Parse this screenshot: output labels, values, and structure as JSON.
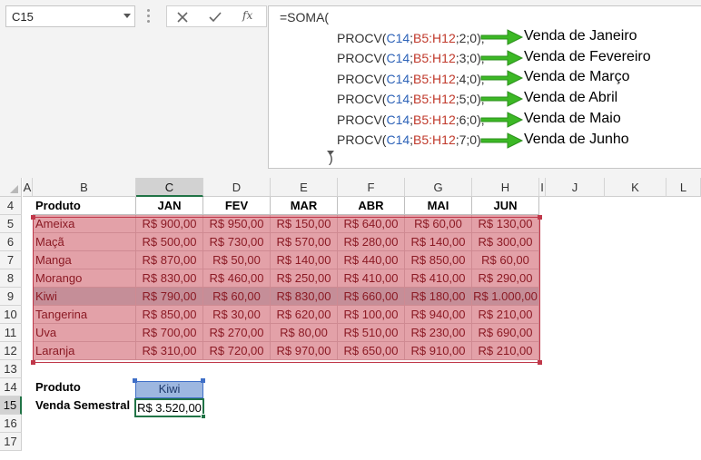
{
  "name_box": {
    "value": "C15"
  },
  "formula_bar": {
    "fx_label": "fx",
    "lines": [
      {
        "prefix": "=SOMA(",
        "c": "",
        "sep1": "",
        "b": "",
        "suffix": ""
      },
      {
        "prefix": "PROCV(",
        "c": "C14",
        "sep1": ";",
        "b": "B5:H12",
        "suffix": ";2;0);"
      },
      {
        "prefix": "PROCV(",
        "c": "C14",
        "sep1": ";",
        "b": "B5:H12",
        "suffix": ";3;0);"
      },
      {
        "prefix": "PROCV(",
        "c": "C14",
        "sep1": ";",
        "b": "B5:H12",
        "suffix": ";4;0);"
      },
      {
        "prefix": "PROCV(",
        "c": "C14",
        "sep1": ";",
        "b": "B5:H12",
        "suffix": ";5;0);"
      },
      {
        "prefix": "PROCV(",
        "c": "C14",
        "sep1": ";",
        "b": "B5:H12",
        "suffix": ";6;0);"
      },
      {
        "prefix": "PROCV(",
        "c": "C14",
        "sep1": ";",
        "b": "B5:H12",
        "suffix": ";7;0)"
      },
      {
        "prefix": ")",
        "c": "",
        "sep1": "",
        "b": "",
        "suffix": ""
      }
    ],
    "annotations": [
      "Venda de Janeiro",
      "Venda de Fevereiro",
      "Venda de Março",
      "Venda de Abril",
      "Venda de Maio",
      "Venda de Junho"
    ],
    "colors": {
      "ref_c14": "#2e63b8",
      "ref_range": "#c0392b",
      "arrow": "#3cb825"
    }
  },
  "columns": [
    "A",
    "B",
    "C",
    "D",
    "E",
    "F",
    "G",
    "H",
    "I",
    "J",
    "K",
    "L"
  ],
  "selected_column": "C",
  "rows": [
    "4",
    "5",
    "6",
    "7",
    "8",
    "9",
    "10",
    "11",
    "12",
    "13",
    "14",
    "15",
    "16",
    "17"
  ],
  "selected_row": "15",
  "table": {
    "headers": [
      "Produto",
      "JAN",
      "FEV",
      "MAR",
      "ABR",
      "MAI",
      "JUN"
    ],
    "rows": [
      [
        "Ameixa",
        "R$ 900,00",
        "R$ 950,00",
        "R$ 150,00",
        "R$ 640,00",
        "R$ 60,00",
        "R$ 130,00"
      ],
      [
        "Maçã",
        "R$ 500,00",
        "R$ 730,00",
        "R$ 570,00",
        "R$ 280,00",
        "R$ 140,00",
        "R$ 300,00"
      ],
      [
        "Manga",
        "R$ 870,00",
        "R$ 50,00",
        "R$ 140,00",
        "R$ 440,00",
        "R$ 850,00",
        "R$ 60,00"
      ],
      [
        "Morango",
        "R$ 830,00",
        "R$ 460,00",
        "R$ 250,00",
        "R$ 410,00",
        "R$ 410,00",
        "R$ 290,00"
      ],
      [
        "Kiwi",
        "R$ 790,00",
        "R$ 60,00",
        "R$ 830,00",
        "R$ 660,00",
        "R$ 180,00",
        "R$ 1.000,00"
      ],
      [
        "Tangerina",
        "R$ 850,00",
        "R$ 30,00",
        "R$ 620,00",
        "R$ 100,00",
        "R$ 940,00",
        "R$ 210,00"
      ],
      [
        "Uva",
        "R$ 700,00",
        "R$ 270,00",
        "R$ 80,00",
        "R$ 510,00",
        "R$ 230,00",
        "R$ 690,00"
      ],
      [
        "Laranja",
        "R$ 310,00",
        "R$ 720,00",
        "R$ 970,00",
        "R$ 650,00",
        "R$ 910,00",
        "R$ 210,00"
      ]
    ],
    "highlighted_row": "Kiwi",
    "colors": {
      "fill": "#e3a1a8",
      "text": "#8b1a24",
      "highlight": "#c58e98"
    }
  },
  "lookup": {
    "produto_label": "Produto",
    "produto_value": "Kiwi",
    "venda_label": "Venda Semestral",
    "venda_value": "R$ 3.520,00"
  }
}
